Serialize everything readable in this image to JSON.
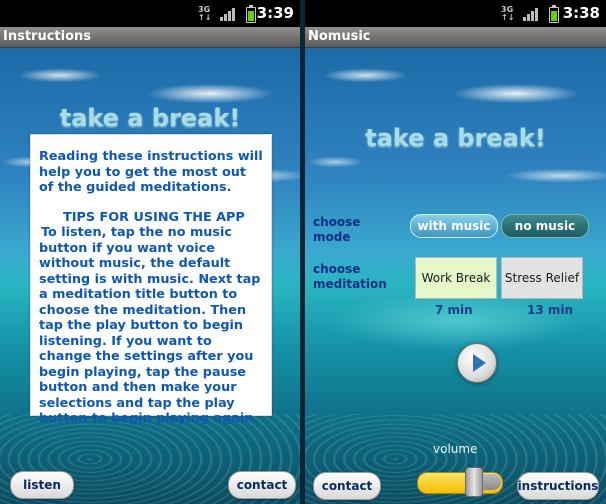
{
  "left": {
    "status": {
      "time": "3:39"
    },
    "title": "Instructions",
    "headline": "take a break!",
    "instructions": {
      "intro": "Reading these instructions will help you to get the most out of the guided meditations.",
      "tips_heading": "TIPS FOR USING THE APP",
      "tips_body": "To listen, tap the no music button if you want voice without music, the default setting is with music. Next tap a meditation title button to choose the meditation. Then tap the play button to begin listening. If you want to change the settings after you begin playing, tap the pause button and then make your selections and tap the play button to begin playing again."
    },
    "buttons": {
      "listen": "listen",
      "contact": "contact"
    }
  },
  "right": {
    "status": {
      "time": "3:38"
    },
    "title": "Nomusic",
    "headline": "take a break!",
    "mode": {
      "label": "choose mode",
      "with_music": "with music",
      "no_music": "no music",
      "selected": "with music"
    },
    "meditation": {
      "label": "choose meditation",
      "options": [
        {
          "title": "Work Break",
          "duration": "7 min",
          "selected": true
        },
        {
          "title": "Stress Relief",
          "duration": "13 min",
          "selected": false
        }
      ]
    },
    "volume": {
      "label": "volume",
      "level": 0.6
    },
    "buttons": {
      "contact": "contact",
      "instructions": "instructions"
    },
    "icons": {
      "play": "play-icon"
    }
  }
}
